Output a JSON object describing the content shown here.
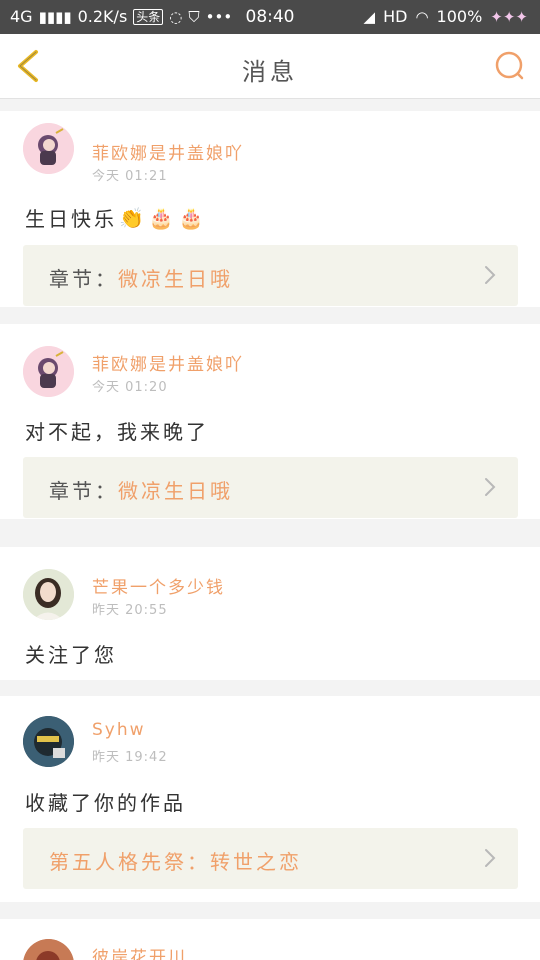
{
  "status_bar": {
    "network": "4G",
    "speed": "0.2K/s",
    "app_badge": "头条",
    "time": "08:40",
    "hd": "HD",
    "battery": "100%"
  },
  "header": {
    "title": "消息",
    "back_icon": "chevron-left-icon",
    "search_icon": "search-icon"
  },
  "colors": {
    "accent": "#f0a06a",
    "back_icon": "#e8b825",
    "chapter_bg": "#f3f3eb"
  },
  "messages": [
    {
      "username": "菲欧娜是井盖娘吖",
      "time": "今天 01:21",
      "content": "生日快乐",
      "emojis": [
        "👏",
        "🎂",
        "🎂"
      ],
      "chapter_label": "章节：",
      "chapter_value": "微凉生日哦"
    },
    {
      "username": "菲欧娜是井盖娘吖",
      "time": "今天 01:20",
      "content": "对不起，我来晚了",
      "chapter_label": "章节：",
      "chapter_value": "微凉生日哦"
    },
    {
      "username": "芒果一个多少钱",
      "time": "昨天 20:55",
      "content": "关注了您"
    },
    {
      "username": "Syhw",
      "time": "昨天 19:42",
      "content": "收藏了你的作品",
      "chapter_value": "第五人格先祭：转世之恋"
    },
    {
      "username": "彼岸花开川"
    }
  ]
}
